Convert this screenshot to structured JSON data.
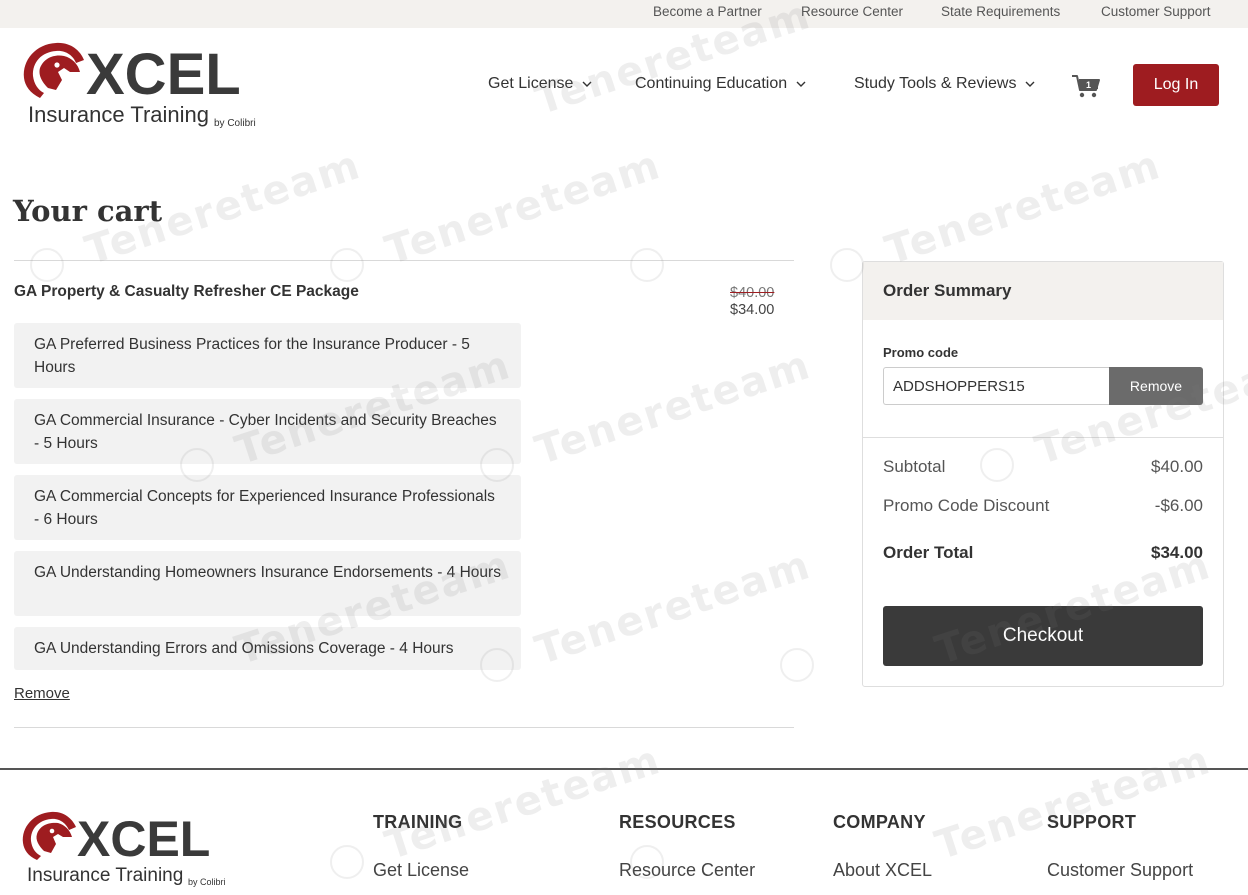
{
  "utility_nav": {
    "items": [
      "Become a Partner",
      "Resource Center",
      "State Requirements",
      "Customer Support"
    ]
  },
  "brand": {
    "logo_text": "XCEL",
    "logo_sub": "Insurance Training",
    "logo_by": "by Colibri",
    "logo_icon": "horse-head-icon",
    "brand_color": "#9e1c20",
    "dark_color": "#3a3a3a"
  },
  "main_nav": {
    "items": [
      "Get License",
      "Continuing Education",
      "Study Tools & Reviews"
    ],
    "cart_count": "1",
    "login_label": "Log In"
  },
  "cart": {
    "title": "Your cart",
    "package": {
      "name": "GA Property & Casualty Refresher CE Package",
      "original_price": "$40.00",
      "price": "$34.00",
      "courses": [
        "GA Preferred Business Practices for the Insurance Producer - 5 Hours",
        "GA Commercial Insurance - Cyber Incidents and Security Breaches - 5 Hours",
        "GA Commercial Concepts for Experienced Insurance Professionals - 6 Hours",
        "GA Understanding Homeowners Insurance Endorsements - 4 Hours",
        "GA Understanding Errors and Omissions Coverage - 4 Hours"
      ],
      "remove_label": "Remove"
    }
  },
  "summary": {
    "title": "Order Summary",
    "promo_label": "Promo code",
    "promo_value": "ADDSHOPPERS15",
    "promo_remove_label": "Remove",
    "subtotal_label": "Subtotal",
    "subtotal_value": "$40.00",
    "discount_label": "Promo Code Discount",
    "discount_value": "-$6.00",
    "total_label": "Order Total",
    "total_value": "$34.00",
    "checkout_label": "Checkout"
  },
  "footer": {
    "columns": [
      {
        "heading": "TRAINING",
        "link": "Get License"
      },
      {
        "heading": "RESOURCES",
        "link": "Resource Center"
      },
      {
        "heading": "COMPANY",
        "link": "About XCEL"
      },
      {
        "heading": "SUPPORT",
        "link": "Customer Support"
      }
    ]
  },
  "watermark": {
    "text": "Tenereteam"
  }
}
